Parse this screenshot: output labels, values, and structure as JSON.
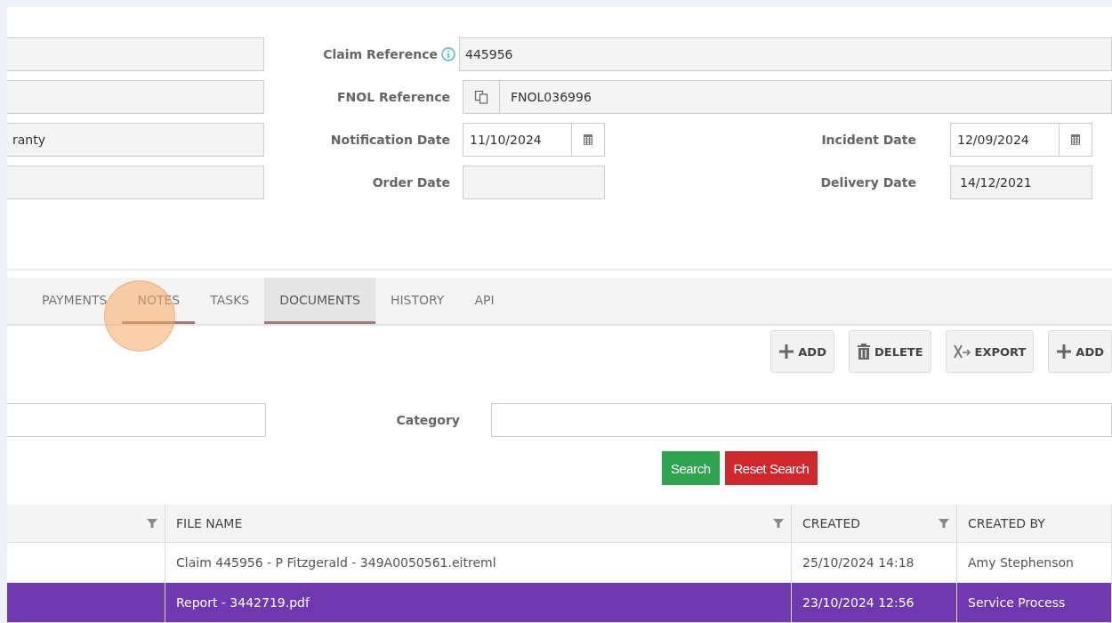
{
  "form": {
    "left_fields": [
      {
        "kind": "empty"
      },
      {
        "kind": "empty"
      },
      {
        "kind": "text",
        "value": "ranty"
      },
      {
        "kind": "empty"
      }
    ],
    "claim_reference": {
      "label": "Claim Reference",
      "value": "445956"
    },
    "fnol_reference": {
      "label": "FNOL Reference",
      "value": "FNOL036996"
    },
    "notification_date": {
      "label": "Notification Date",
      "value": "11/10/2024"
    },
    "incident_date": {
      "label": "Incident Date",
      "value": "12/09/2024"
    },
    "order_date": {
      "label": "Order Date"
    },
    "delivery_date": {
      "label": "Delivery Date",
      "value": "14/12/2021"
    }
  },
  "tabs": [
    {
      "label": "PAYMENTS",
      "selected": false,
      "hovered": false
    },
    {
      "label": "NOTES",
      "selected": false,
      "hovered": true
    },
    {
      "label": "TASKS",
      "selected": false,
      "hovered": false
    },
    {
      "label": "DOCUMENTS",
      "selected": true,
      "hovered": false
    },
    {
      "label": "HISTORY",
      "selected": false,
      "hovered": false
    },
    {
      "label": "API",
      "selected": false,
      "hovered": false
    }
  ],
  "toolbar": [
    {
      "kind": "add",
      "label": "ADD"
    },
    {
      "kind": "delete",
      "label": "DELETE"
    },
    {
      "kind": "export",
      "label": "EXPORT"
    },
    {
      "kind": "add",
      "label": "ADD"
    }
  ],
  "filters": {
    "category_label": "Category",
    "search_button": "Search",
    "reset_button": "Reset Search"
  },
  "table": {
    "columns": [
      "",
      "FILE NAME",
      "CREATED",
      "CREATED BY"
    ],
    "rows": [
      {
        "selected": false,
        "cells": [
          "",
          "Claim 445956 - P Fitzgerald - 349A0050561.eitreml",
          "25/10/2024 14:18",
          "Amy Stephenson"
        ]
      },
      {
        "selected": true,
        "cells": [
          "",
          "Report - 3442719.pdf",
          "23/10/2024 12:56",
          "Service Process"
        ]
      }
    ]
  }
}
